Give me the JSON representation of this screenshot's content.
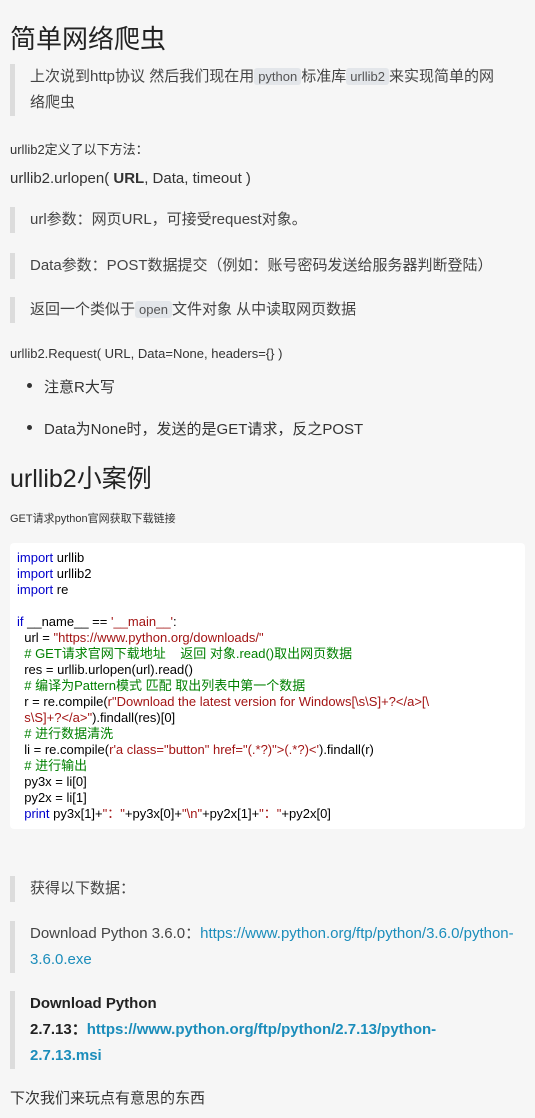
{
  "title": "简单网络爬虫",
  "intro": {
    "part1": "上次说到http协议 然后我们现在用",
    "code1": "python",
    "part2": "标准库",
    "code2": "urllib2",
    "part3": "来实现简单的网",
    "part4": "络爬虫"
  },
  "methods_heading": "urllib2定义了以下方法：",
  "urlopen_sig": {
    "prefix": "urllib2.urlopen( ",
    "bold": "URL",
    "suffix": ", Data, timeout )"
  },
  "quotes": {
    "url_param": "url参数：网页URL，可接受request对象。",
    "data_param": "Data参数：POST数据提交（例如：账号密码发送给服务器判断登陆）",
    "return_pre": "返回一个类似于",
    "return_code": "open",
    "return_post": "文件对象 从中读取网页数据"
  },
  "request_sig": "urllib2.Request( URL, Data=None, headers={} )",
  "bullets": [
    "注意R大写",
    "Data为None时，发送的是GET请求，反之POST"
  ],
  "section2_title": "urllib2小案例",
  "section2_desc": "GET请求python官网获取下载链接",
  "code": {
    "l1_kw": "import",
    "l1_rest": " urllib",
    "l2_kw": "import",
    "l2_rest": " urllib2",
    "l3_kw": "import",
    "l3_rest": " re",
    "l5_kw": "if",
    "l5_a": " __name__ == ",
    "l5_str": "'__main__'",
    "l5_b": ":",
    "l6_a": "  url = ",
    "l6_str": "\"https://www.python.org/downloads/\"",
    "l7_cm": "  # GET请求官网下载地址    返回 对象.read()取出网页数据",
    "l8": "  res = urllib.urlopen(url).read()",
    "l9_cm": "  # 编译为Pattern模式 匹配 取出列表中第一个数据",
    "l10_a": "  r = re.compile(",
    "l10_str": "r\"Download the latest version for Windows[\\s\\S]+?</a>[\\",
    "l11_str": "  s\\S]+?</a>\"",
    "l11_b": ").findall(res)[0]",
    "l12_cm": "  # 进行数据清洗",
    "l13_a": "  li = re.compile(",
    "l13_str": "r'a class=\"button\" href=\"(.*?)\">(.*?)<'",
    "l13_b": ").findall(r)",
    "l14_cm": "  # 进行输出",
    "l15": "  py3x = li[0]",
    "l16": "  py2x = li[1]",
    "l17_kw": "  print",
    "l17_a": " py3x[1]+",
    "l17_s1": "\"：\"",
    "l17_b": "+py3x[0]+",
    "l17_s2": "\"\\n\"",
    "l17_c": "+py2x[1]+",
    "l17_s3": "\"：\"",
    "l17_d": "+py2x[0]"
  },
  "result_heading": "获得以下数据：",
  "result1": {
    "label": "Download Python 3.6.0：",
    "link_line1": "https://www.python.org/ftp/python/3.6.0/python-",
    "link_line2": "3.6.0.exe"
  },
  "result2": {
    "label_line1": "Download Python",
    "label_line2": "2.7.13：",
    "link_line1": "https://www.python.org/ftp/python/2.7.13/python-",
    "link_line2": "2.7.13.msi"
  },
  "closing": "下次我们来玩点有意思的东西",
  "colors": {
    "background": "#f6f6f6",
    "link": "#1b8dbb",
    "keyword": "#0000cc",
    "string": "#a31515",
    "comment": "#008000",
    "quote_border": "#dcdcdc"
  }
}
